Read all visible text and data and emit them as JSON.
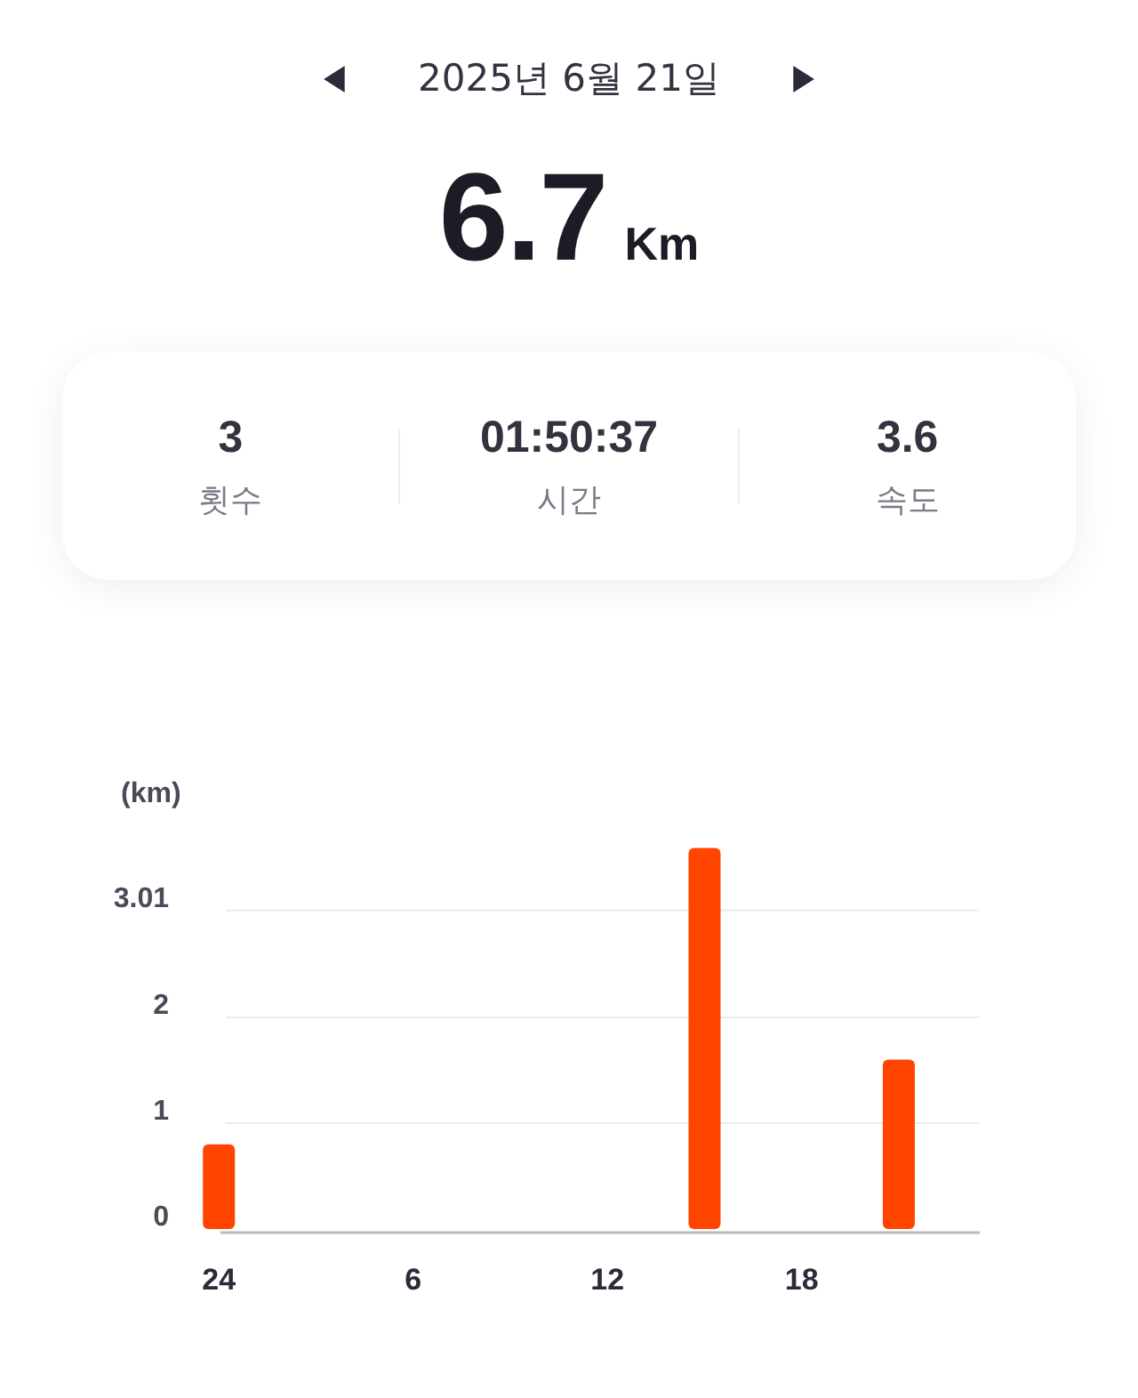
{
  "date_nav": {
    "date": "2025년 6월 21일"
  },
  "distance": {
    "value": "6.7",
    "unit": "Km"
  },
  "stats": [
    {
      "value": "3",
      "label": "횟수"
    },
    {
      "value": "01:50:37",
      "label": "시간"
    },
    {
      "value": "3.6",
      "label": "속도"
    }
  ],
  "chart": {
    "chart_data": {
      "type": "bar",
      "ylabel": "(km)",
      "categories": [
        "24",
        null,
        null,
        null,
        null,
        null,
        "6",
        null,
        null,
        null,
        null,
        null,
        "12",
        null,
        null,
        null,
        null,
        null,
        "18",
        null,
        null,
        null,
        null,
        null
      ],
      "series": [
        {
          "color": "#ff4500",
          "values": [
            0.8,
            null,
            null,
            null,
            null,
            null,
            null,
            null,
            null,
            null,
            null,
            null,
            null,
            null,
            null,
            3.6,
            null,
            null,
            null,
            null,
            null,
            1.6,
            null,
            null
          ]
        }
      ],
      "grid": true,
      "ylim": [
        0,
        3.6
      ],
      "yticks": [
        0,
        1,
        2,
        3.01
      ]
    }
  }
}
